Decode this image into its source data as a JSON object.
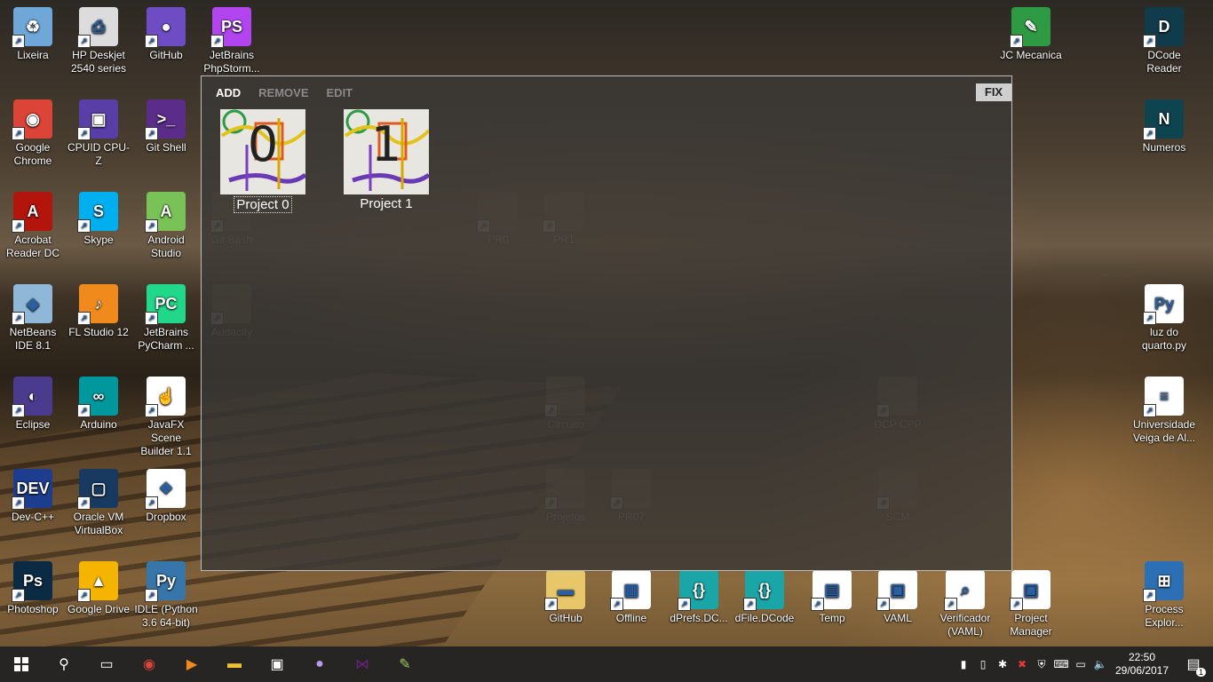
{
  "desktop_icons": [
    {
      "label": "Lixeira",
      "icon": "recycle-bin-icon",
      "color": "#6fa7d8",
      "glyph": "♻"
    },
    {
      "label": "HP Deskjet 2540 series",
      "icon": "printer-icon",
      "color": "#dcdcdc",
      "glyph": "⎙"
    },
    {
      "label": "GitHub",
      "icon": "github-icon",
      "color": "#6e4cc4",
      "glyph": "●"
    },
    {
      "label": "JetBrains PhpStorm...",
      "icon": "phpstorm-icon",
      "color": "#b345f1",
      "glyph": "PS"
    },
    {
      "label": "Google Chrome",
      "icon": "chrome-icon",
      "color": "#db4437",
      "glyph": "◉"
    },
    {
      "label": "CPUID CPU-Z",
      "icon": "cpuz-icon",
      "color": "#5a3ea8",
      "glyph": "▣"
    },
    {
      "label": "Git Shell",
      "icon": "git-shell-icon",
      "color": "#5b2c8a",
      "glyph": ">_"
    },
    {
      "label": "Acrobat Reader DC",
      "icon": "acrobat-icon",
      "color": "#b3140b",
      "glyph": "A"
    },
    {
      "label": "Skype",
      "icon": "skype-icon",
      "color": "#00aff0",
      "glyph": "S"
    },
    {
      "label": "Android Studio",
      "icon": "android-studio-icon",
      "color": "#78c257",
      "glyph": "A"
    },
    {
      "label": "NetBeans IDE 8.1",
      "icon": "netbeans-icon",
      "color": "#8fb8d8",
      "glyph": "◆"
    },
    {
      "label": "FL Studio 12",
      "icon": "fl-studio-icon",
      "color": "#f08a1c",
      "glyph": "♪"
    },
    {
      "label": "JetBrains PyCharm ...",
      "icon": "pycharm-icon",
      "color": "#21d789",
      "glyph": "PC"
    },
    {
      "label": "Eclipse",
      "icon": "eclipse-icon",
      "color": "#4b3b8f",
      "glyph": "◐"
    },
    {
      "label": "Arduino",
      "icon": "arduino-icon",
      "color": "#00979d",
      "glyph": "∞"
    },
    {
      "label": "JavaFX Scene Builder 1.1",
      "icon": "scene-builder-icon",
      "color": "#ffffff",
      "glyph": "☝"
    },
    {
      "label": "Dev-C++",
      "icon": "dev-cpp-icon",
      "color": "#1d3d8f",
      "glyph": "DEV"
    },
    {
      "label": "Oracle VM VirtualBox",
      "icon": "virtualbox-icon",
      "color": "#183a61",
      "glyph": "▢"
    },
    {
      "label": "Dropbox",
      "icon": "dropbox-icon",
      "color": "#ffffff",
      "glyph": "❖"
    },
    {
      "label": "Photoshop",
      "icon": "photoshop-icon",
      "color": "#0b2b45",
      "glyph": "Ps"
    },
    {
      "label": "Google Drive",
      "icon": "google-drive-icon",
      "color": "#f4b400",
      "glyph": "▲"
    },
    {
      "label": "IDLE (Python 3.6 64-bit)",
      "icon": "python-idle-icon",
      "color": "#3776ab",
      "glyph": "Py"
    },
    {
      "label": "JC Mecanica",
      "icon": "jc-mecanica-icon",
      "color": "#2e9b44",
      "glyph": "✎"
    },
    {
      "label": "DCode Reader",
      "icon": "dcode-reader-icon",
      "color": "#0f3b4a",
      "glyph": "D"
    },
    {
      "label": "Numeros",
      "icon": "numeros-icon",
      "color": "#0e4450",
      "glyph": "N"
    },
    {
      "label": "luz do quarto.py",
      "icon": "python-file-icon",
      "color": "#ffffff",
      "glyph": "Py"
    },
    {
      "label": "Universidade Veiga de Al...",
      "icon": "document-icon",
      "color": "#ffffff",
      "glyph": "≡"
    },
    {
      "label": "Process Explor...",
      "icon": "process-explorer-icon",
      "color": "#2d6fb5",
      "glyph": "⊞"
    },
    {
      "label": "GitHub",
      "icon": "folder-icon",
      "color": "#e8c66a",
      "glyph": "▬"
    },
    {
      "label": "Offline",
      "icon": "offline-icon",
      "color": "#ffffff",
      "glyph": "▦"
    },
    {
      "label": "dPrefs.DC...",
      "icon": "dcode-file-icon",
      "color": "#1aa6a6",
      "glyph": "{}"
    },
    {
      "label": "dFile.DCode",
      "icon": "dcode-file-icon",
      "color": "#1aa6a6",
      "glyph": "{}"
    },
    {
      "label": "Temp",
      "icon": "temp-file-icon",
      "color": "#ffffff",
      "glyph": "▤"
    },
    {
      "label": "VAML",
      "icon": "vaml-icon",
      "color": "#ffffff",
      "glyph": "▣"
    },
    {
      "label": "Verificador (VAML)",
      "icon": "verificador-icon",
      "color": "#ffffff",
      "glyph": "⌕"
    },
    {
      "label": "Project Manager",
      "icon": "project-manager-icon",
      "color": "#ffffff",
      "glyph": "▣"
    }
  ],
  "ghost_icons": [
    {
      "label": "Git Bash",
      "icon": "git-bash-icon"
    },
    {
      "label": "Audacity",
      "icon": "audacity-icon"
    },
    {
      "label": "PR0",
      "icon": "folder-icon"
    },
    {
      "label": "PR1",
      "icon": "folder-icon"
    },
    {
      "label": "Circuito",
      "icon": "folder-icon"
    },
    {
      "label": "Projetos",
      "icon": "folder-icon"
    },
    {
      "label": "PR07",
      "icon": "folder-icon"
    },
    {
      "label": "DCP CPP",
      "icon": "vaml-icon"
    },
    {
      "label": "SCM",
      "icon": "vaml-icon"
    }
  ],
  "overlay": {
    "menu": {
      "add": "ADD",
      "remove": "REMOVE",
      "edit": "EDIT"
    },
    "fix": "FIX",
    "projects": [
      {
        "number": "0",
        "label": "Project 0"
      },
      {
        "number": "1",
        "label": "Project 1"
      }
    ]
  },
  "taskbar": {
    "time": "22:50",
    "date": "29/06/2017",
    "notification_count": "1"
  }
}
